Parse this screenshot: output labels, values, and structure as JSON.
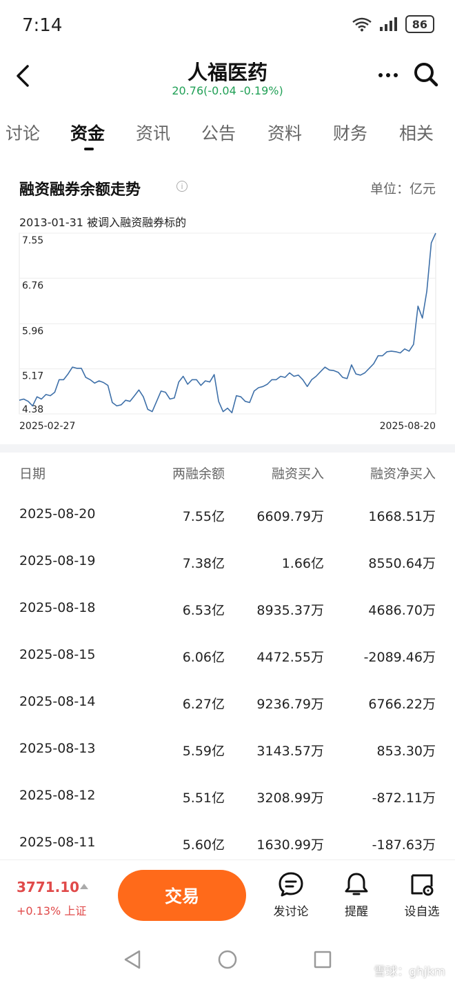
{
  "status": {
    "time": "7:14",
    "battery": "86"
  },
  "nav": {
    "title": "人福医药",
    "subtitle": "20.76(-0.04 -0.19%)"
  },
  "tabs": [
    {
      "label": "讨论",
      "active": false
    },
    {
      "label": "资金",
      "active": true
    },
    {
      "label": "资讯",
      "active": false
    },
    {
      "label": "公告",
      "active": false
    },
    {
      "label": "资料",
      "active": false
    },
    {
      "label": "财务",
      "active": false
    },
    {
      "label": "相关",
      "active": false
    }
  ],
  "section": {
    "title": "融资融券余额走势",
    "unit": "单位：亿元",
    "note": "2013-01-31 被调入融资融券标的"
  },
  "chart_data": {
    "type": "line",
    "start_label": "2025-02-27",
    "end_label": "2025-08-20",
    "y_ticks": [
      "7.55",
      "6.76",
      "5.96",
      "5.17",
      "4.38"
    ],
    "ylim": [
      4.38,
      7.55
    ],
    "grid": true,
    "line_color": "#3d6fa8",
    "series": [
      {
        "values": [
          4.62,
          4.64,
          4.6,
          4.52,
          4.68,
          4.64,
          4.72,
          4.7,
          4.76,
          4.98,
          4.98,
          5.08,
          5.2,
          5.18,
          5.18,
          5.02,
          4.98,
          4.92,
          4.96,
          4.93,
          4.88,
          4.58,
          4.52,
          4.54,
          4.62,
          4.6,
          4.7,
          4.8,
          4.68,
          4.46,
          4.42,
          4.6,
          4.78,
          4.76,
          4.64,
          4.66,
          4.94,
          5.04,
          4.9,
          4.98,
          4.98,
          4.88,
          4.96,
          4.94,
          5.07,
          4.6,
          4.42,
          4.48,
          4.4,
          4.7,
          4.68,
          4.6,
          4.58,
          4.78,
          4.84,
          4.86,
          4.9,
          4.98,
          4.98,
          5.04,
          5.02,
          5.1,
          5.04,
          5.06,
          4.98,
          4.86,
          4.98,
          5.04,
          5.12,
          5.2,
          5.15,
          5.14,
          5.11,
          5.02,
          5.0,
          5.24,
          5.08,
          5.06,
          5.1,
          5.18,
          5.26,
          5.4,
          5.4,
          5.47,
          5.48,
          5.47,
          5.45,
          5.52,
          5.48,
          5.6,
          6.27,
          6.06,
          6.53,
          7.38,
          7.55
        ]
      }
    ]
  },
  "table": {
    "headers": [
      "日期",
      "两融余额",
      "融资买入",
      "融资净买入"
    ],
    "rows": [
      [
        "2025-08-20",
        "7.55亿",
        "6609.79万",
        "1668.51万"
      ],
      [
        "2025-08-19",
        "7.38亿",
        "1.66亿",
        "8550.64万"
      ],
      [
        "2025-08-18",
        "6.53亿",
        "8935.37万",
        "4686.70万"
      ],
      [
        "2025-08-15",
        "6.06亿",
        "4472.55万",
        "-2089.46万"
      ],
      [
        "2025-08-14",
        "6.27亿",
        "9236.79万",
        "6766.22万"
      ],
      [
        "2025-08-13",
        "5.59亿",
        "3143.57万",
        "853.30万"
      ],
      [
        "2025-08-12",
        "5.51亿",
        "3208.99万",
        "-872.11万"
      ],
      [
        "2025-08-11",
        "5.60亿",
        "1630.99万",
        "-187.63万"
      ]
    ]
  },
  "bottom": {
    "index_value": "3771.10",
    "index_change": "+0.13% 上证",
    "trade_label": "交易",
    "actions": [
      {
        "label": "发讨论",
        "icon": "chat-bubble-icon"
      },
      {
        "label": "提醒",
        "icon": "bell-icon"
      },
      {
        "label": "设自选",
        "icon": "add-watchlist-icon"
      }
    ]
  },
  "watermark": "雪球：ghjkm"
}
